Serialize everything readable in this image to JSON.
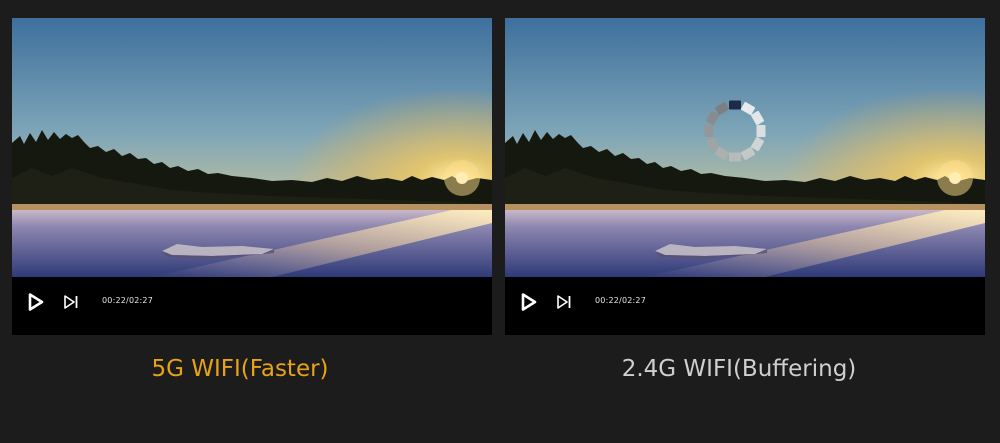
{
  "players": [
    {
      "time": "00:22/02:27",
      "caption": "5G WIFI(Faster)",
      "buffering": false
    },
    {
      "time": "00:22/02:27",
      "caption": "2.4G WIFI(Buffering)",
      "buffering": true
    }
  ],
  "colors": {
    "caption_fast": "#e8a317",
    "caption_buffering": "#cfcfcf",
    "background": "#1c1c1c"
  },
  "icons": [
    "play-icon",
    "skip-next-icon",
    "loading-spinner-icon"
  ]
}
